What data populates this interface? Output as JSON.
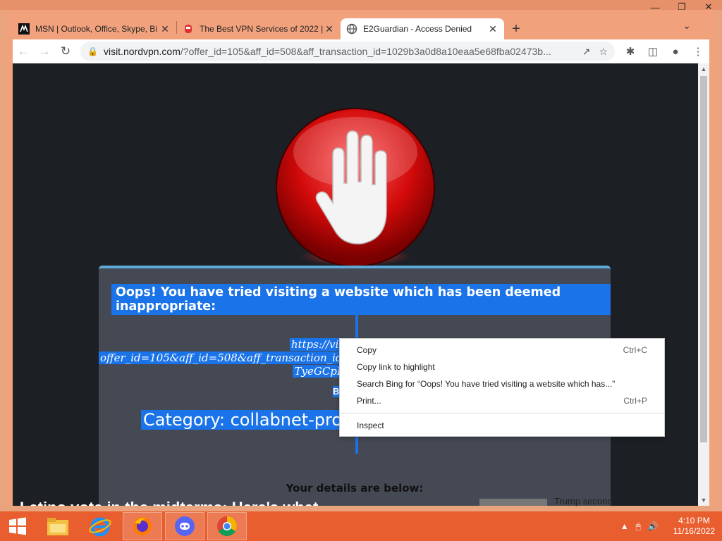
{
  "browser": {
    "tabs": [
      {
        "title": "MSN | Outlook, Office, Skype, Bi",
        "icon": "msn-icon",
        "active": false
      },
      {
        "title": "The Best VPN Services of 2022 | (",
        "icon": "vpn-site-icon",
        "active": false
      },
      {
        "title": "E2Guardian - Access Denied",
        "icon": "globe-icon",
        "active": true
      }
    ],
    "url_host": "visit.nordvpn.com",
    "url_rest": "/?offer_id=105&aff_id=508&aff_transaction_id=1029b3a0d8a10eaa5e68fba02473b..."
  },
  "page": {
    "heading": "Oops! You have tried visiting a website which has been deemed inappropriate:",
    "url_lines": [
      "https://vis",
      "offer_id=105&aff_id=508&aff_transaction_id=1",
      "TyeGCpP"
    ],
    "partial_mark": "B",
    "category": "Category: collabnet-proxy",
    "details": "Your details are below:",
    "bg_news": "Latino vote in the midterms: Here's what...",
    "bg_trump": "Trump second"
  },
  "context_menu": {
    "items": [
      {
        "label": "Copy",
        "shortcut": "Ctrl+C"
      },
      {
        "label": "Copy link to highlight",
        "shortcut": ""
      },
      {
        "label": "Search Bing for “Oops! You have tried visiting a website which has...”",
        "shortcut": ""
      },
      {
        "label": "Print...",
        "shortcut": "Ctrl+P"
      },
      {
        "label": "Inspect",
        "shortcut": ""
      }
    ]
  },
  "taskbar": {
    "time": "4:10 PM",
    "date": "11/16/2022",
    "apps": [
      "file-explorer-icon",
      "internet-explorer-icon",
      "firefox-icon",
      "discord-icon",
      "chrome-icon"
    ]
  },
  "colors": {
    "accent_orange": "#e85e2f",
    "selection_blue": "#1a73e8",
    "panel": "#444954"
  }
}
